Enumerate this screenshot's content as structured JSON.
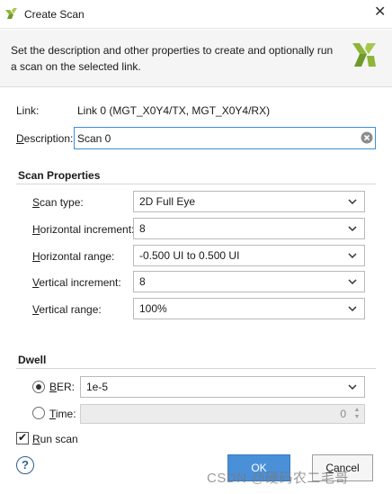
{
  "window": {
    "title": "Create Scan",
    "close_glyph": "✕"
  },
  "header": {
    "description": "Set the description and other properties to create and optionally run a scan on the selected link."
  },
  "link": {
    "label": "Link:",
    "value": "Link 0 (MGT_X0Y4/TX, MGT_X0Y4/RX)"
  },
  "description": {
    "label_mnemonic": "D",
    "label_rest": "escription:",
    "value": "Scan 0"
  },
  "scan_properties": {
    "title": "Scan Properties",
    "scan_type": {
      "label_mnemonic": "S",
      "label_rest": "can type:",
      "value": "2D Full Eye"
    },
    "horizontal_increment": {
      "label_mnemonic": "H",
      "label_rest": "orizontal increment:",
      "value": "8"
    },
    "horizontal_range": {
      "label_mnemonic": "H",
      "label_rest": "orizontal range:",
      "value": "-0.500 UI to 0.500 UI"
    },
    "vertical_increment": {
      "label_mnemonic": "V",
      "label_rest": "ertical increment:",
      "value": "8"
    },
    "vertical_range": {
      "label_mnemonic": "V",
      "label_rest": "ertical range:",
      "value": "100%"
    }
  },
  "dwell": {
    "title": "Dwell",
    "ber": {
      "label_mnemonic": "B",
      "label_rest": "ER:",
      "value": "1e-5",
      "selected": true
    },
    "time": {
      "label_mnemonic": "T",
      "label_rest": "ime:",
      "value": "0",
      "selected": false
    }
  },
  "run_scan": {
    "label_mnemonic": "R",
    "label_rest": "un scan",
    "checked": true,
    "check_glyph": "✔"
  },
  "buttons": {
    "help": "?",
    "ok": "OK",
    "cancel_mnemonic": "C",
    "cancel_rest": "ancel"
  },
  "watermark": "CSDN @硬码农二毛哥",
  "colors": {
    "brand": "#8db53a",
    "ok_button": "#4a90d9",
    "focus_border": "#3c8fd6"
  }
}
